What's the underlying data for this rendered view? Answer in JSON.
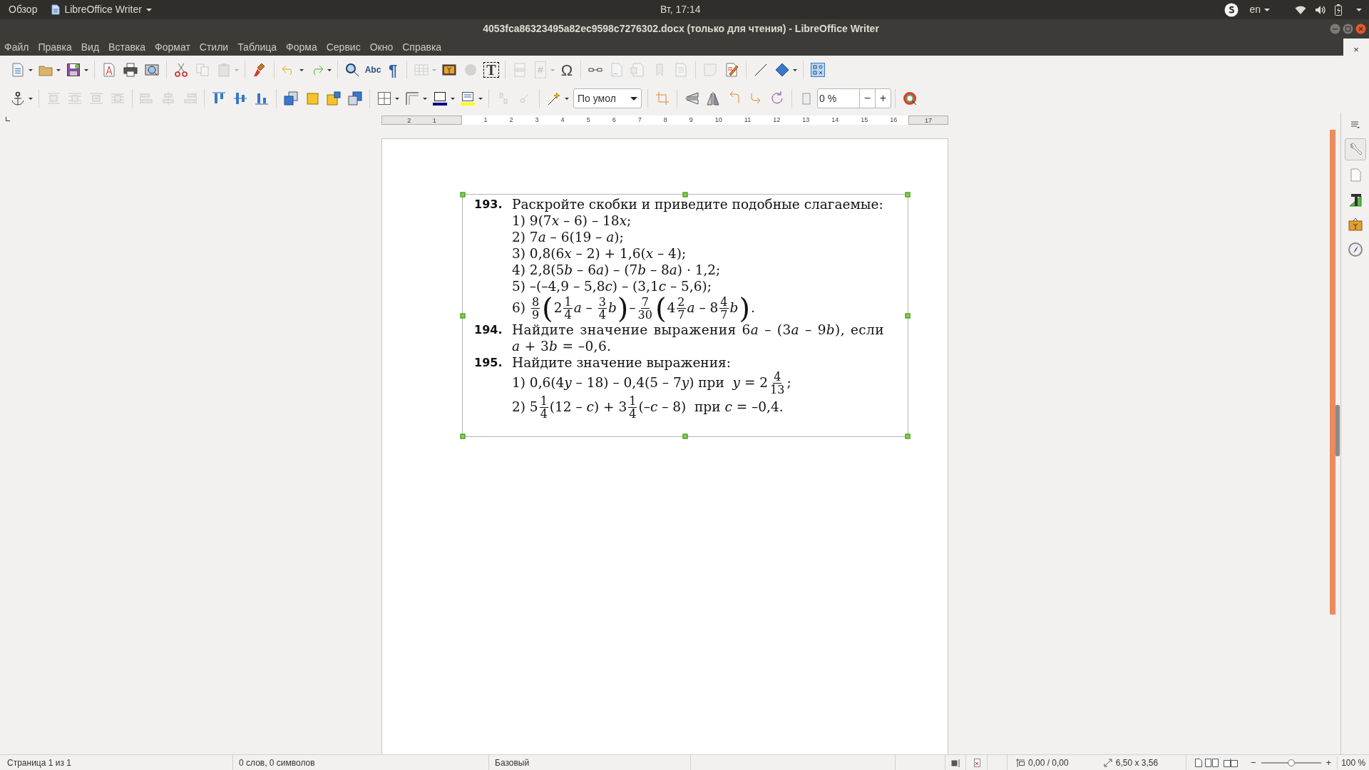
{
  "top_bar": {
    "activities": "Обзор",
    "app_menu": "LibreOffice Writer",
    "clock": "Вт, 17:14",
    "keyboard_layout": "en"
  },
  "window": {
    "title": "4053fca86323495a82ec9598c7276302.docx (только для чтения) - LibreOffice Writer"
  },
  "menu": [
    "Файл",
    "Правка",
    "Вид",
    "Вставка",
    "Формат",
    "Стили",
    "Таблица",
    "Форма",
    "Сервис",
    "Окно",
    "Справка"
  ],
  "close_document": "×",
  "toolbars": [
    {
      "groups": [
        [
          {
            "kind": "new-document",
            "disabled": false,
            "dropdown": true
          },
          {
            "kind": "open",
            "disabled": false,
            "dropdown": true
          },
          {
            "kind": "save",
            "disabled": false,
            "dropdown": true
          }
        ],
        [
          {
            "kind": "export-pdf",
            "disabled": false,
            "dropdown": false
          },
          {
            "kind": "print",
            "disabled": false,
            "dropdown": false
          },
          {
            "kind": "print-preview",
            "disabled": false,
            "dropdown": false
          }
        ],
        [
          {
            "kind": "cut",
            "disabled": false,
            "dropdown": false
          },
          {
            "kind": "copy",
            "disabled": true,
            "dropdown": false
          },
          {
            "kind": "paste",
            "disabled": true,
            "dropdown": true
          }
        ],
        [
          {
            "kind": "clone-formatting",
            "disabled": false,
            "dropdown": false
          }
        ],
        [
          {
            "kind": "undo",
            "disabled": false,
            "dropdown": true
          },
          {
            "kind": "redo",
            "disabled": false,
            "dropdown": true
          }
        ],
        [
          {
            "kind": "find-replace",
            "disabled": false,
            "dropdown": false
          },
          {
            "kind": "spelling",
            "label": "Abc",
            "disabled": false,
            "dropdown": false
          },
          {
            "kind": "formatting-marks",
            "label": "¶",
            "disabled": false,
            "dropdown": false
          }
        ],
        [
          {
            "kind": "table",
            "disabled": true,
            "dropdown": true
          },
          {
            "kind": "image",
            "disabled": false,
            "dropdown": false
          },
          {
            "kind": "chart",
            "disabled": true,
            "dropdown": false
          },
          {
            "kind": "text-box",
            "label": "T",
            "disabled": false,
            "dropdown": false
          }
        ],
        [
          {
            "kind": "page-break",
            "disabled": true,
            "dropdown": false
          },
          {
            "kind": "field",
            "label": "#",
            "disabled": true,
            "dropdown": true
          },
          {
            "kind": "special-character",
            "label": "Ω",
            "disabled": false,
            "dropdown": false
          }
        ],
        [
          {
            "kind": "hyperlink",
            "disabled": false,
            "dropdown": false
          },
          {
            "kind": "footnote",
            "disabled": true,
            "dropdown": false
          },
          {
            "kind": "endnote",
            "disabled": true,
            "dropdown": false
          },
          {
            "kind": "bookmark",
            "disabled": true,
            "dropdown": false
          },
          {
            "kind": "cross-reference",
            "disabled": true,
            "dropdown": false
          }
        ],
        [
          {
            "kind": "comment",
            "disabled": true,
            "dropdown": false
          },
          {
            "kind": "track-changes",
            "disabled": false,
            "dropdown": false
          }
        ],
        [
          {
            "kind": "line",
            "disabled": false,
            "dropdown": false
          },
          {
            "kind": "basic-shapes",
            "disabled": false,
            "dropdown": true
          }
        ],
        [
          {
            "kind": "draw-functions",
            "disabled": false,
            "dropdown": false
          }
        ]
      ]
    },
    {
      "groups": [
        [
          {
            "kind": "anchor",
            "disabled": false,
            "dropdown": true
          }
        ],
        [
          {
            "kind": "wrap-off",
            "disabled": true,
            "dropdown": false
          },
          {
            "kind": "wrap-page",
            "disabled": true,
            "dropdown": false
          },
          {
            "kind": "wrap-optimal",
            "disabled": true,
            "dropdown": false
          },
          {
            "kind": "wrap-through",
            "disabled": true,
            "dropdown": false
          }
        ],
        [
          {
            "kind": "align-left",
            "disabled": true,
            "dropdown": false
          },
          {
            "kind": "align-center",
            "disabled": true,
            "dropdown": false
          },
          {
            "kind": "align-right",
            "disabled": true,
            "dropdown": false
          }
        ],
        [
          {
            "kind": "align-top",
            "disabled": false,
            "dropdown": false
          },
          {
            "kind": "align-middle",
            "disabled": false,
            "dropdown": false
          },
          {
            "kind": "align-bottom",
            "disabled": false,
            "dropdown": false
          }
        ],
        [
          {
            "kind": "bring-to-front",
            "disabled": false,
            "dropdown": false
          },
          {
            "kind": "bring-forward",
            "disabled": false,
            "dropdown": false
          },
          {
            "kind": "send-backward",
            "disabled": false,
            "dropdown": false
          },
          {
            "kind": "send-to-back",
            "disabled": false,
            "dropdown": false
          }
        ],
        [
          {
            "kind": "borders",
            "disabled": false,
            "dropdown": true
          },
          {
            "kind": "border-style",
            "disabled": false,
            "dropdown": true
          },
          {
            "kind": "border-color",
            "disabled": false,
            "dropdown": true
          },
          {
            "kind": "area",
            "disabled": false,
            "dropdown": true
          }
        ],
        [
          {
            "kind": "group",
            "disabled": true,
            "dropdown": false
          },
          {
            "kind": "enter-group",
            "disabled": true,
            "dropdown": false
          }
        ],
        [
          {
            "kind": "fontwork",
            "disabled": false,
            "dropdown": true
          },
          {
            "kind": "mode-box",
            "value": "По умол",
            "disabled": false,
            "dropdown": false
          }
        ],
        [
          {
            "kind": "crop",
            "disabled": false,
            "dropdown": false
          }
        ],
        [
          {
            "kind": "flip-vertical",
            "disabled": false,
            "dropdown": false
          },
          {
            "kind": "flip-horizontal",
            "disabled": false,
            "dropdown": false
          },
          {
            "kind": "rotate-left",
            "disabled": false,
            "dropdown": false
          },
          {
            "kind": "rotate-right",
            "disabled": false,
            "dropdown": false
          },
          {
            "kind": "rotate",
            "disabled": false,
            "dropdown": false
          }
        ],
        [
          {
            "kind": "transparency",
            "disabled": false,
            "dropdown": false
          },
          {
            "kind": "spin-field",
            "value": "0 %",
            "decrement": "−",
            "increment": "+",
            "disabled": false,
            "dropdown": false
          }
        ],
        [
          {
            "kind": "color-replacer",
            "disabled": false,
            "dropdown": false
          }
        ]
      ]
    }
  ],
  "ruler": {
    "left_labels": [
      "2",
      "1"
    ],
    "labels": [
      "1",
      "2",
      "3",
      "4",
      "5",
      "6",
      "7",
      "8",
      "9",
      "10",
      "11",
      "12",
      "13",
      "14",
      "15",
      "16"
    ],
    "right_labels": [
      "17"
    ]
  },
  "exercises": [
    {
      "number": "193.",
      "text": [
        {
          "kind": "text",
          "text": "Раскройте скобки и приведите подобные слагаемые:"
        }
      ],
      "items": [
        {
          "parts": [
            {
              "kind": "text",
              "text": "1) 9(7"
            },
            {
              "kind": "var",
              "text": "x"
            },
            {
              "kind": "text",
              "text": " – 6) – 18"
            },
            {
              "kind": "var",
              "text": "x"
            },
            {
              "kind": "text",
              "text": ";"
            }
          ]
        },
        {
          "parts": [
            {
              "kind": "text",
              "text": "2) 7"
            },
            {
              "kind": "var",
              "text": "a"
            },
            {
              "kind": "text",
              "text": " – 6(19 – "
            },
            {
              "kind": "var",
              "text": "a"
            },
            {
              "kind": "text",
              "text": ");"
            }
          ]
        },
        {
          "parts": [
            {
              "kind": "text",
              "text": "3) 0,8(6"
            },
            {
              "kind": "var",
              "text": "x"
            },
            {
              "kind": "text",
              "text": " – 2) + 1,6("
            },
            {
              "kind": "var",
              "text": "x"
            },
            {
              "kind": "text",
              "text": " – 4);"
            }
          ]
        },
        {
          "parts": [
            {
              "kind": "text",
              "text": "4) 2,8(5"
            },
            {
              "kind": "var",
              "text": "b"
            },
            {
              "kind": "text",
              "text": " – 6"
            },
            {
              "kind": "var",
              "text": "a"
            },
            {
              "kind": "text",
              "text": ") – (7"
            },
            {
              "kind": "var",
              "text": "b"
            },
            {
              "kind": "text",
              "text": " – 8"
            },
            {
              "kind": "var",
              "text": "a"
            },
            {
              "kind": "text",
              "text": ") · 1,2;"
            }
          ]
        },
        {
          "parts": [
            {
              "kind": "text",
              "text": "5) –(–4,9 – 5,8"
            },
            {
              "kind": "var",
              "text": "c"
            },
            {
              "kind": "text",
              "text": ") – (3,1"
            },
            {
              "kind": "var",
              "text": "c"
            },
            {
              "kind": "text",
              "text": " – 5,6);"
            }
          ]
        },
        {
          "parts": [
            {
              "kind": "text",
              "text": "6) "
            },
            {
              "kind": "frac",
              "num": "8",
              "den": "9"
            },
            {
              "kind": "big",
              "text": "("
            },
            {
              "kind": "text",
              "text": "2"
            },
            {
              "kind": "frac",
              "num": "1",
              "den": "4"
            },
            {
              "kind": "var",
              "text": "a"
            },
            {
              "kind": "text",
              "text": " – "
            },
            {
              "kind": "frac",
              "num": "3",
              "den": "4"
            },
            {
              "kind": "var",
              "text": "b"
            },
            {
              "kind": "big",
              "text": ")"
            },
            {
              "kind": "text",
              "text": "–"
            },
            {
              "kind": "frac",
              "num": "7",
              "den": "30"
            },
            {
              "kind": "big",
              "text": "("
            },
            {
              "kind": "text",
              "text": "4"
            },
            {
              "kind": "frac",
              "num": "2",
              "den": "7"
            },
            {
              "kind": "var",
              "text": "a"
            },
            {
              "kind": "text",
              "text": " – 8"
            },
            {
              "kind": "frac",
              "num": "4",
              "den": "7"
            },
            {
              "kind": "var",
              "text": "b"
            },
            {
              "kind": "big",
              "text": ")"
            },
            {
              "kind": "text",
              "text": "."
            }
          ]
        }
      ]
    },
    {
      "number": "194.",
      "text": [
        {
          "kind": "text",
          "text": "Найдите значение выражения 6"
        },
        {
          "kind": "var",
          "text": "a"
        },
        {
          "kind": "text",
          "text": " – (3"
        },
        {
          "kind": "var",
          "text": "a"
        },
        {
          "kind": "text",
          "text": " – 9"
        },
        {
          "kind": "var",
          "text": "b"
        },
        {
          "kind": "text",
          "text": "), если "
        },
        {
          "kind": "var",
          "text": "a"
        },
        {
          "kind": "text",
          "text": " + 3"
        },
        {
          "kind": "var",
          "text": "b"
        },
        {
          "kind": "text",
          "text": " = –0,6."
        }
      ]
    },
    {
      "number": "195.",
      "text": [
        {
          "kind": "text",
          "text": "Найдите значение выражения:"
        }
      ],
      "items": [
        {
          "parts": [
            {
              "kind": "text",
              "text": "1) 0,6(4"
            },
            {
              "kind": "var",
              "text": "y"
            },
            {
              "kind": "text",
              "text": " – 18) – 0,4(5 – 7"
            },
            {
              "kind": "var",
              "text": "y"
            },
            {
              "kind": "text",
              "text": ") при  "
            },
            {
              "kind": "var",
              "text": "y"
            },
            {
              "kind": "text",
              "text": " = 2"
            },
            {
              "kind": "frac",
              "num": "4",
              "den": "13"
            },
            {
              "kind": "text",
              "text": ";"
            }
          ]
        },
        {
          "parts": [
            {
              "kind": "text",
              "text": "2) 5"
            },
            {
              "kind": "frac",
              "num": "1",
              "den": "4"
            },
            {
              "kind": "text",
              "text": "(12 – "
            },
            {
              "kind": "var",
              "text": "c"
            },
            {
              "kind": "text",
              "text": ") + 3"
            },
            {
              "kind": "frac",
              "num": "1",
              "den": "4"
            },
            {
              "kind": "text",
              "text": "(–"
            },
            {
              "kind": "var",
              "text": "c"
            },
            {
              "kind": "text",
              "text": " – 8)  при "
            },
            {
              "kind": "var",
              "text": "c"
            },
            {
              "kind": "text",
              "text": " = –0,4."
            }
          ]
        }
      ]
    }
  ],
  "sidebar": {
    "tabs": [
      {
        "kind": "properties",
        "selected": true
      },
      {
        "kind": "page",
        "selected": false
      },
      {
        "kind": "styles",
        "selected": false
      },
      {
        "kind": "gallery",
        "selected": false
      },
      {
        "kind": "navigator",
        "selected": false
      }
    ]
  },
  "status_bar": {
    "page": "Страница 1 из 1",
    "words": "0 слов, 0 символов",
    "page_style": "Базовый",
    "position": "0,00 / 0,00",
    "size": "6,50 x 3,56",
    "zoom_out": "−",
    "zoom_in": "+",
    "zoom": "100 %"
  },
  "zoom_slider": {
    "level": 0.5
  }
}
